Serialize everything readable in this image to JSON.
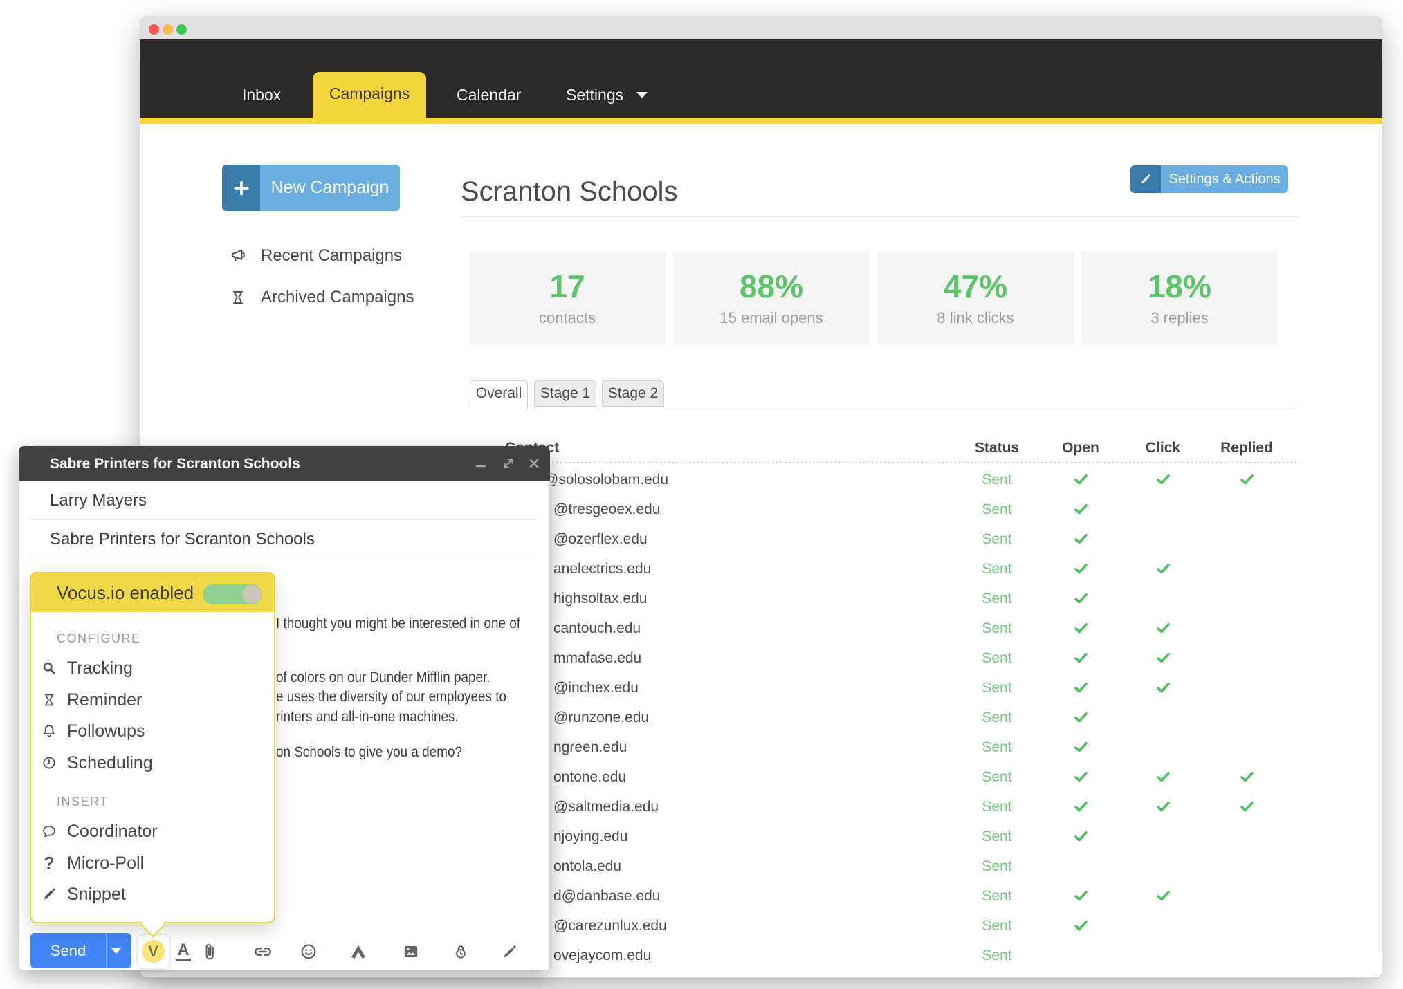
{
  "navbar": {
    "items": [
      "Inbox",
      "Campaigns",
      "Calendar",
      "Settings"
    ],
    "active": "Campaigns"
  },
  "sidebar": {
    "new_campaign_label": "New Campaign",
    "recent_label": "Recent Campaigns",
    "archived_label": "Archived Campaigns"
  },
  "header": {
    "title": "Scranton Schools",
    "settings_button": "Settings & Actions"
  },
  "stats": [
    {
      "value": "17",
      "label": "contacts"
    },
    {
      "value": "88%",
      "label": "15 email opens"
    },
    {
      "value": "47%",
      "label": "8 link clicks"
    },
    {
      "value": "18%",
      "label": "3 replies"
    }
  ],
  "stage_tabs": {
    "items": [
      "Overall",
      "Stage 1",
      "Stage 2"
    ],
    "active": "Overall"
  },
  "table": {
    "headers": {
      "contact": "Contact",
      "status": "Status",
      "open": "Open",
      "click": "Click",
      "replied": "Replied"
    },
    "rows": [
      {
        "email": "@solosolobam.edu",
        "status": "Sent",
        "open": true,
        "click": true,
        "replied": true
      },
      {
        "email": "@tresgeoex.edu",
        "status": "Sent",
        "open": true,
        "click": false,
        "replied": false
      },
      {
        "email": "@ozerflex.edu",
        "status": "Sent",
        "open": true,
        "click": false,
        "replied": false
      },
      {
        "email": "anelectrics.edu",
        "status": "Sent",
        "open": true,
        "click": true,
        "replied": false
      },
      {
        "email": "highsoltax.edu",
        "status": "Sent",
        "open": true,
        "click": false,
        "replied": false
      },
      {
        "email": "cantouch.edu",
        "status": "Sent",
        "open": true,
        "click": true,
        "replied": false
      },
      {
        "email": "mmafase.edu",
        "status": "Sent",
        "open": true,
        "click": true,
        "replied": false
      },
      {
        "email": "@inchex.edu",
        "status": "Sent",
        "open": true,
        "click": true,
        "replied": false
      },
      {
        "email": "@runzone.edu",
        "status": "Sent",
        "open": true,
        "click": false,
        "replied": false
      },
      {
        "email": "ngreen.edu",
        "status": "Sent",
        "open": true,
        "click": false,
        "replied": false
      },
      {
        "email": "ontone.edu",
        "status": "Sent",
        "open": true,
        "click": true,
        "replied": true
      },
      {
        "email": "@saltmedia.edu",
        "status": "Sent",
        "open": true,
        "click": true,
        "replied": true
      },
      {
        "email": "njoying.edu",
        "status": "Sent",
        "open": true,
        "click": false,
        "replied": false
      },
      {
        "email": "ontola.edu",
        "status": "Sent",
        "open": false,
        "click": false,
        "replied": false
      },
      {
        "email": "d@danbase.edu",
        "status": "Sent",
        "open": true,
        "click": true,
        "replied": false
      },
      {
        "email": "@carezunlux.edu",
        "status": "Sent",
        "open": true,
        "click": false,
        "replied": false
      },
      {
        "email": "ovejaycom.edu",
        "status": "Sent",
        "open": false,
        "click": false,
        "replied": false
      }
    ]
  },
  "compose": {
    "title": "Sabre Printers for Scranton Schools",
    "recipient": "Larry Mayers",
    "subject": "Sabre Printers for Scranton Schools",
    "body_fragments": [
      "I thought you might be interested in one of",
      "of colors on our Dunder Mifflin paper.",
      "e uses the diversity of our employees to",
      "rinters and all-in-one machines.",
      "on Schools to give you a demo?"
    ],
    "send_label": "Send",
    "vocus_initial": "V"
  },
  "vocus_menu": {
    "header": "Vocus.io enabled",
    "toggle_on": true,
    "sections": [
      {
        "label": "CONFIGURE",
        "items": [
          {
            "icon": "search-icon",
            "label": "Tracking"
          },
          {
            "icon": "hourglass-icon",
            "label": "Reminder"
          },
          {
            "icon": "bell-icon",
            "label": "Followups"
          },
          {
            "icon": "clock-icon",
            "label": "Scheduling"
          }
        ]
      },
      {
        "label": "INSERT",
        "items": [
          {
            "icon": "chat-icon",
            "label": "Coordinator"
          },
          {
            "icon": "question-icon",
            "label": "Micro-Poll"
          },
          {
            "icon": "pencil-icon",
            "label": "Snippet"
          }
        ]
      }
    ]
  },
  "colors": {
    "accent_yellow": "#f4d63c",
    "panel_yellow": "#f0d948",
    "green": "#5ec46a",
    "sent_green": "#70c87d",
    "check_green": "#4fbe63",
    "send_blue": "#4285f4",
    "button_blue_light": "#69ade1",
    "button_blue_dark": "#3a7dab",
    "navbar_dark": "#2d2b2a",
    "traffic_red": "#f4564f",
    "traffic_yellow": "#f6bc4e",
    "traffic_green": "#3bc84c"
  }
}
